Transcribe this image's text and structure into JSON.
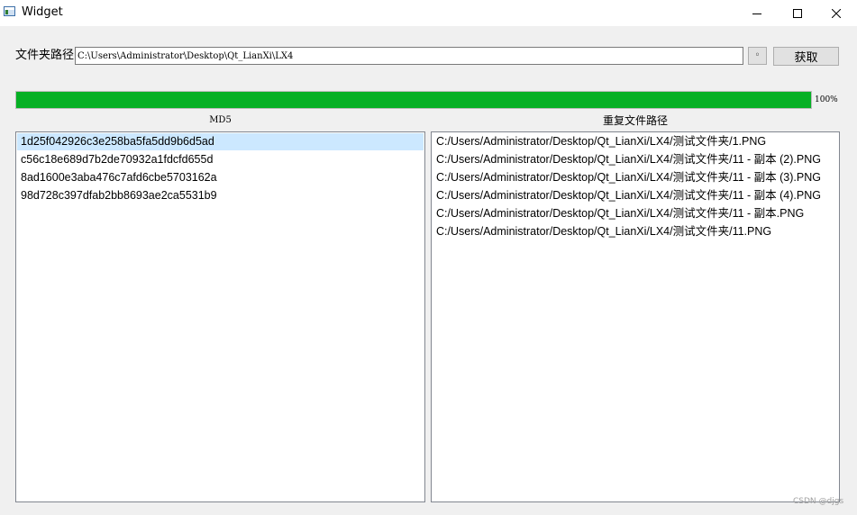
{
  "window": {
    "title": "Widget",
    "app_icon": "window-app-icon",
    "controls": [
      "minimize-icon",
      "maximize-icon",
      "close-icon"
    ]
  },
  "folder": {
    "label": "文件夹路径",
    "path_value": "C:\\Users\\Administrator\\Desktop\\Qt_LianXi\\LX4",
    "browse_label": "◦",
    "fetch_label": "获取"
  },
  "progress": {
    "percent": 100,
    "text": "100%",
    "fill_color": "#06b025"
  },
  "md5": {
    "header": "MD5",
    "items": [
      "1d25f042926c3e258ba5fa5dd9b6d5ad",
      "c56c18e689d7b2de70932a1fdcfd655d",
      "8ad1600e3aba476c7afd6cbe5703162a",
      "98d728c397dfab2bb8693ae2ca5531b9"
    ],
    "selected_index": 0
  },
  "duplicates": {
    "header": "重复文件路径",
    "items": [
      "C:/Users/Administrator/Desktop/Qt_LianXi/LX4/测试文件夹/1.PNG",
      "C:/Users/Administrator/Desktop/Qt_LianXi/LX4/测试文件夹/11 - 副本 (2).PNG",
      "C:/Users/Administrator/Desktop/Qt_LianXi/LX4/测试文件夹/11 - 副本 (3).PNG",
      "C:/Users/Administrator/Desktop/Qt_LianXi/LX4/测试文件夹/11 - 副本 (4).PNG",
      "C:/Users/Administrator/Desktop/Qt_LianXi/LX4/测试文件夹/11 - 副本.PNG",
      "C:/Users/Administrator/Desktop/Qt_LianXi/LX4/测试文件夹/11.PNG"
    ]
  },
  "watermark": "CSDN @djgs",
  "colors": {
    "selection": "#cce8ff",
    "progress": "#06b025"
  }
}
